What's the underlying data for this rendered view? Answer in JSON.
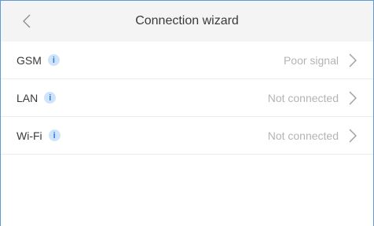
{
  "header": {
    "title": "Connection wizard",
    "back_icon": "chevron-left-icon"
  },
  "items": [
    {
      "label": "GSM",
      "info_icon": "info-icon",
      "info_glyph": "i",
      "status": "Poor signal",
      "chevron_icon": "chevron-right-icon"
    },
    {
      "label": "LAN",
      "info_icon": "info-icon",
      "info_glyph": "i",
      "status": "Not connected",
      "chevron_icon": "chevron-right-icon"
    },
    {
      "label": "Wi-Fi",
      "info_icon": "info-icon",
      "info_glyph": "i",
      "status": "Not connected",
      "chevron_icon": "chevron-right-icon"
    }
  ],
  "colors": {
    "accent": "#2b7de0",
    "status_text": "#b4b4b4",
    "header_bg": "#f4f4f5"
  }
}
